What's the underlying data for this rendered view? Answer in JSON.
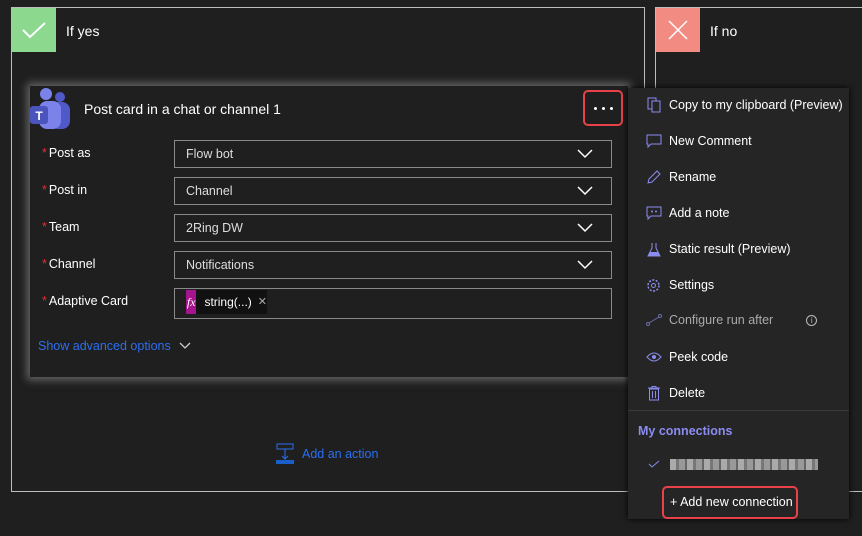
{
  "yes_branch": {
    "label": "If yes",
    "color": "#8bd88e"
  },
  "no_branch": {
    "label": "If no",
    "color": "#f28b82"
  },
  "card": {
    "title": "Post card in a chat or channel 1",
    "icon": "teams-icon",
    "fields": [
      {
        "label": "Post as",
        "value": "Flow bot",
        "required": true
      },
      {
        "label": "Post in",
        "value": "Channel",
        "required": true
      },
      {
        "label": "Team",
        "value": "2Ring DW",
        "required": true
      },
      {
        "label": "Channel",
        "value": "Notifications",
        "required": true
      },
      {
        "label": "Adaptive Card",
        "token": "string(...)",
        "token_icon": "fx",
        "required": true
      }
    ],
    "required_mark": "*",
    "advanced": "Show advanced options"
  },
  "add_action": "Add an action",
  "menu": {
    "items": [
      {
        "label": "Copy to my clipboard (Preview)",
        "icon": "copy-icon"
      },
      {
        "label": "New Comment",
        "icon": "comment-icon"
      },
      {
        "label": "Rename",
        "icon": "pencil-icon"
      },
      {
        "label": "Add a note",
        "icon": "note-icon"
      },
      {
        "label": "Static result (Preview)",
        "icon": "flask-icon"
      },
      {
        "label": "Settings",
        "icon": "gear-icon"
      },
      {
        "label": "Configure run after",
        "icon": "run-after-icon",
        "disabled": true
      },
      {
        "label": "Peek code",
        "icon": "eye-icon"
      },
      {
        "label": "Delete",
        "icon": "trash-icon"
      }
    ],
    "connections_header": "My connections",
    "add_connection": "+ Add new connection"
  },
  "colors": {
    "accent": "#8b8cf0",
    "link": "#2b6ff0",
    "highlight": "#e8414a",
    "fx": "#a4148c"
  }
}
